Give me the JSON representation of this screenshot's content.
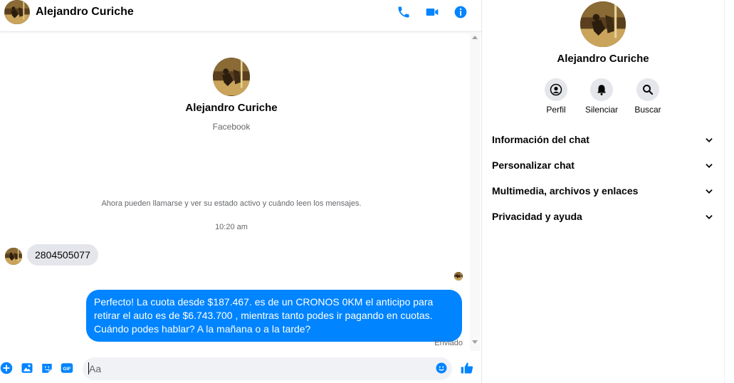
{
  "header": {
    "contact_name": "Alejandro Curiche",
    "icons": [
      "phone-icon",
      "video-camera-icon",
      "info-icon"
    ]
  },
  "intro": {
    "name": "Alejandro Curiche",
    "subtitle": "Facebook"
  },
  "conversation": {
    "notice": "Ahora pueden llamarse y ver su estado activo y cuándo leen los mensajes.",
    "timestamp": "10:20 am",
    "incoming": [
      {
        "text": "2804505077"
      }
    ],
    "outgoing": [
      {
        "text": "Perfecto! La cuota desde $187.467. es de un CRONOS 0KM el anticipo para retirar el auto es de $6.743.700 , mientras tanto podes ir pagando en cuotas. Cuándo podes hablar? A la mañana o a la tarde?"
      }
    ],
    "status": "Enviado"
  },
  "composer": {
    "placeholder": "Aa",
    "icons": [
      "plus-icon",
      "image-icon",
      "sticker-icon",
      "gif-icon",
      "emoji-icon",
      "thumbs-up-icon"
    ]
  },
  "sidebar": {
    "name": "Alejandro Curiche",
    "actions": [
      {
        "label": "Perfil",
        "icon": "profile-icon"
      },
      {
        "label": "Silenciar",
        "icon": "bell-icon"
      },
      {
        "label": "Buscar",
        "icon": "search-icon"
      }
    ],
    "sections": [
      {
        "label": "Información del chat"
      },
      {
        "label": "Personalizar chat"
      },
      {
        "label": "Multimedia, archivos y enlaces"
      },
      {
        "label": "Privacidad y ayuda"
      }
    ]
  },
  "colors": {
    "accent": "#0084ff",
    "incoming_bubble": "#e4e6eb",
    "secondary_text": "#65676b"
  }
}
